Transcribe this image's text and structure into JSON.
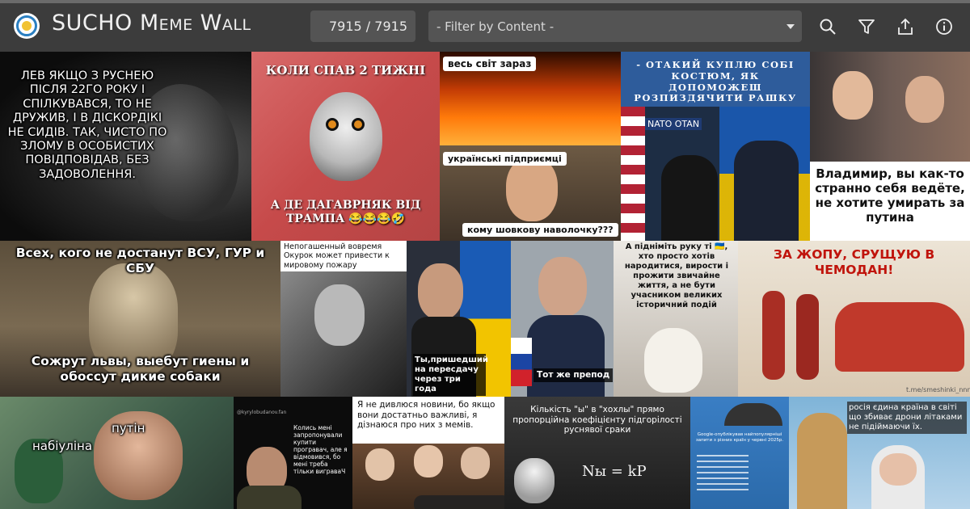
{
  "header": {
    "app_title": "SUCHO Meme Wall",
    "counter": "7915 / 7915",
    "filter_placeholder": "- Filter by Content -",
    "accent_color": "#3c3c3c",
    "toolbar": {
      "search_icon": "search-icon",
      "filter_icon": "filter-icon",
      "share_icon": "share-icon",
      "info_icon": "info-icon"
    }
  },
  "memes": {
    "m1": {
      "caption": "ЛЕВ ЯКЩО З РУСНЕЮ ПІСЛЯ 22ГО РОКУ І СПІЛКУВАВСЯ, ТО НЕ ДРУЖИВ, І В ДІСКОРДІКІ НЕ СИДІВ. ТАК, ЧИСТО ПО ЗЛОМУ В ОСОБИСТИХ ПОВІДПОВІДАВ, БЕЗ ЗАДОВОЛЕННЯ."
    },
    "m2": {
      "top": "КОЛИ СПАВ 2 ТИЖНІ",
      "bottom": "А ДЕ ДАГАВРНЯК ВІД ТРАМПА 😂😂😂🤣"
    },
    "m3": {
      "top": "весь світ зараз",
      "middle": "українські підприємці",
      "bottom": "кому шовкову наволочку???"
    },
    "m4": {
      "caption": "- ОТАКИЙ КУПЛЮ СОБІ КОСТЮМ, ЯК ДОПОМОЖЕШ РОЗПИЗДЯЧИТИ РАШКУ",
      "sign": "NATO OTAN"
    },
    "m5": {
      "caption": "Владимир, вы как-то странно себя ведёте, не хотите умирать за путина"
    },
    "m6": {
      "top": "Всех, кого не достанут ВСУ, ГУР и СБУ",
      "bottom": "Сожрут львы, выебут гиены и обоссут дикие собаки"
    },
    "m7": {
      "caption": "Непогашенный вовремя Окурок может привести к мировому пожару"
    },
    "m8": {
      "left": "Ты,пришедший на пересдачу через три года",
      "right": "Тот же препод"
    },
    "m9": {
      "caption": "А підніміть руку ті 🇺🇦, хто просто хотів народитися, вирости і прожити звичайне життя, а не бути учасником великих історичний подій"
    },
    "m10": {
      "caption": "ЗА ЖОПУ, СРУЩУЮ В ЧЕМОДАН!",
      "credit": "t.me/smeshinki_nnn"
    },
    "m11": {
      "left": "набіуліна",
      "right": "путін"
    },
    "m12": {
      "caption": "Колись мені запропонували купити програвач, але я відмовився, бо мені треба тільки виграваЧ",
      "handle": "@kyrylobudanov.fan"
    },
    "m13": {
      "caption": "Я не дивлюся новини, бо якщо вони достатньо важливі, я дізнаюся про них з мемів."
    },
    "m14": {
      "caption": "Кількість \"ы\" в \"хохлы\" прямо пропорційна коефіцієнту підгорілості руснявої сраки",
      "formula": "Nы = kP"
    },
    "m15": {
      "caption": "Google-опублікував найпопулярніші запити з різних країн у червні 2025р."
    },
    "m16": {
      "caption": "росія єдина країна в світі що збиває дрони літаками не підіймаючи їх."
    }
  }
}
